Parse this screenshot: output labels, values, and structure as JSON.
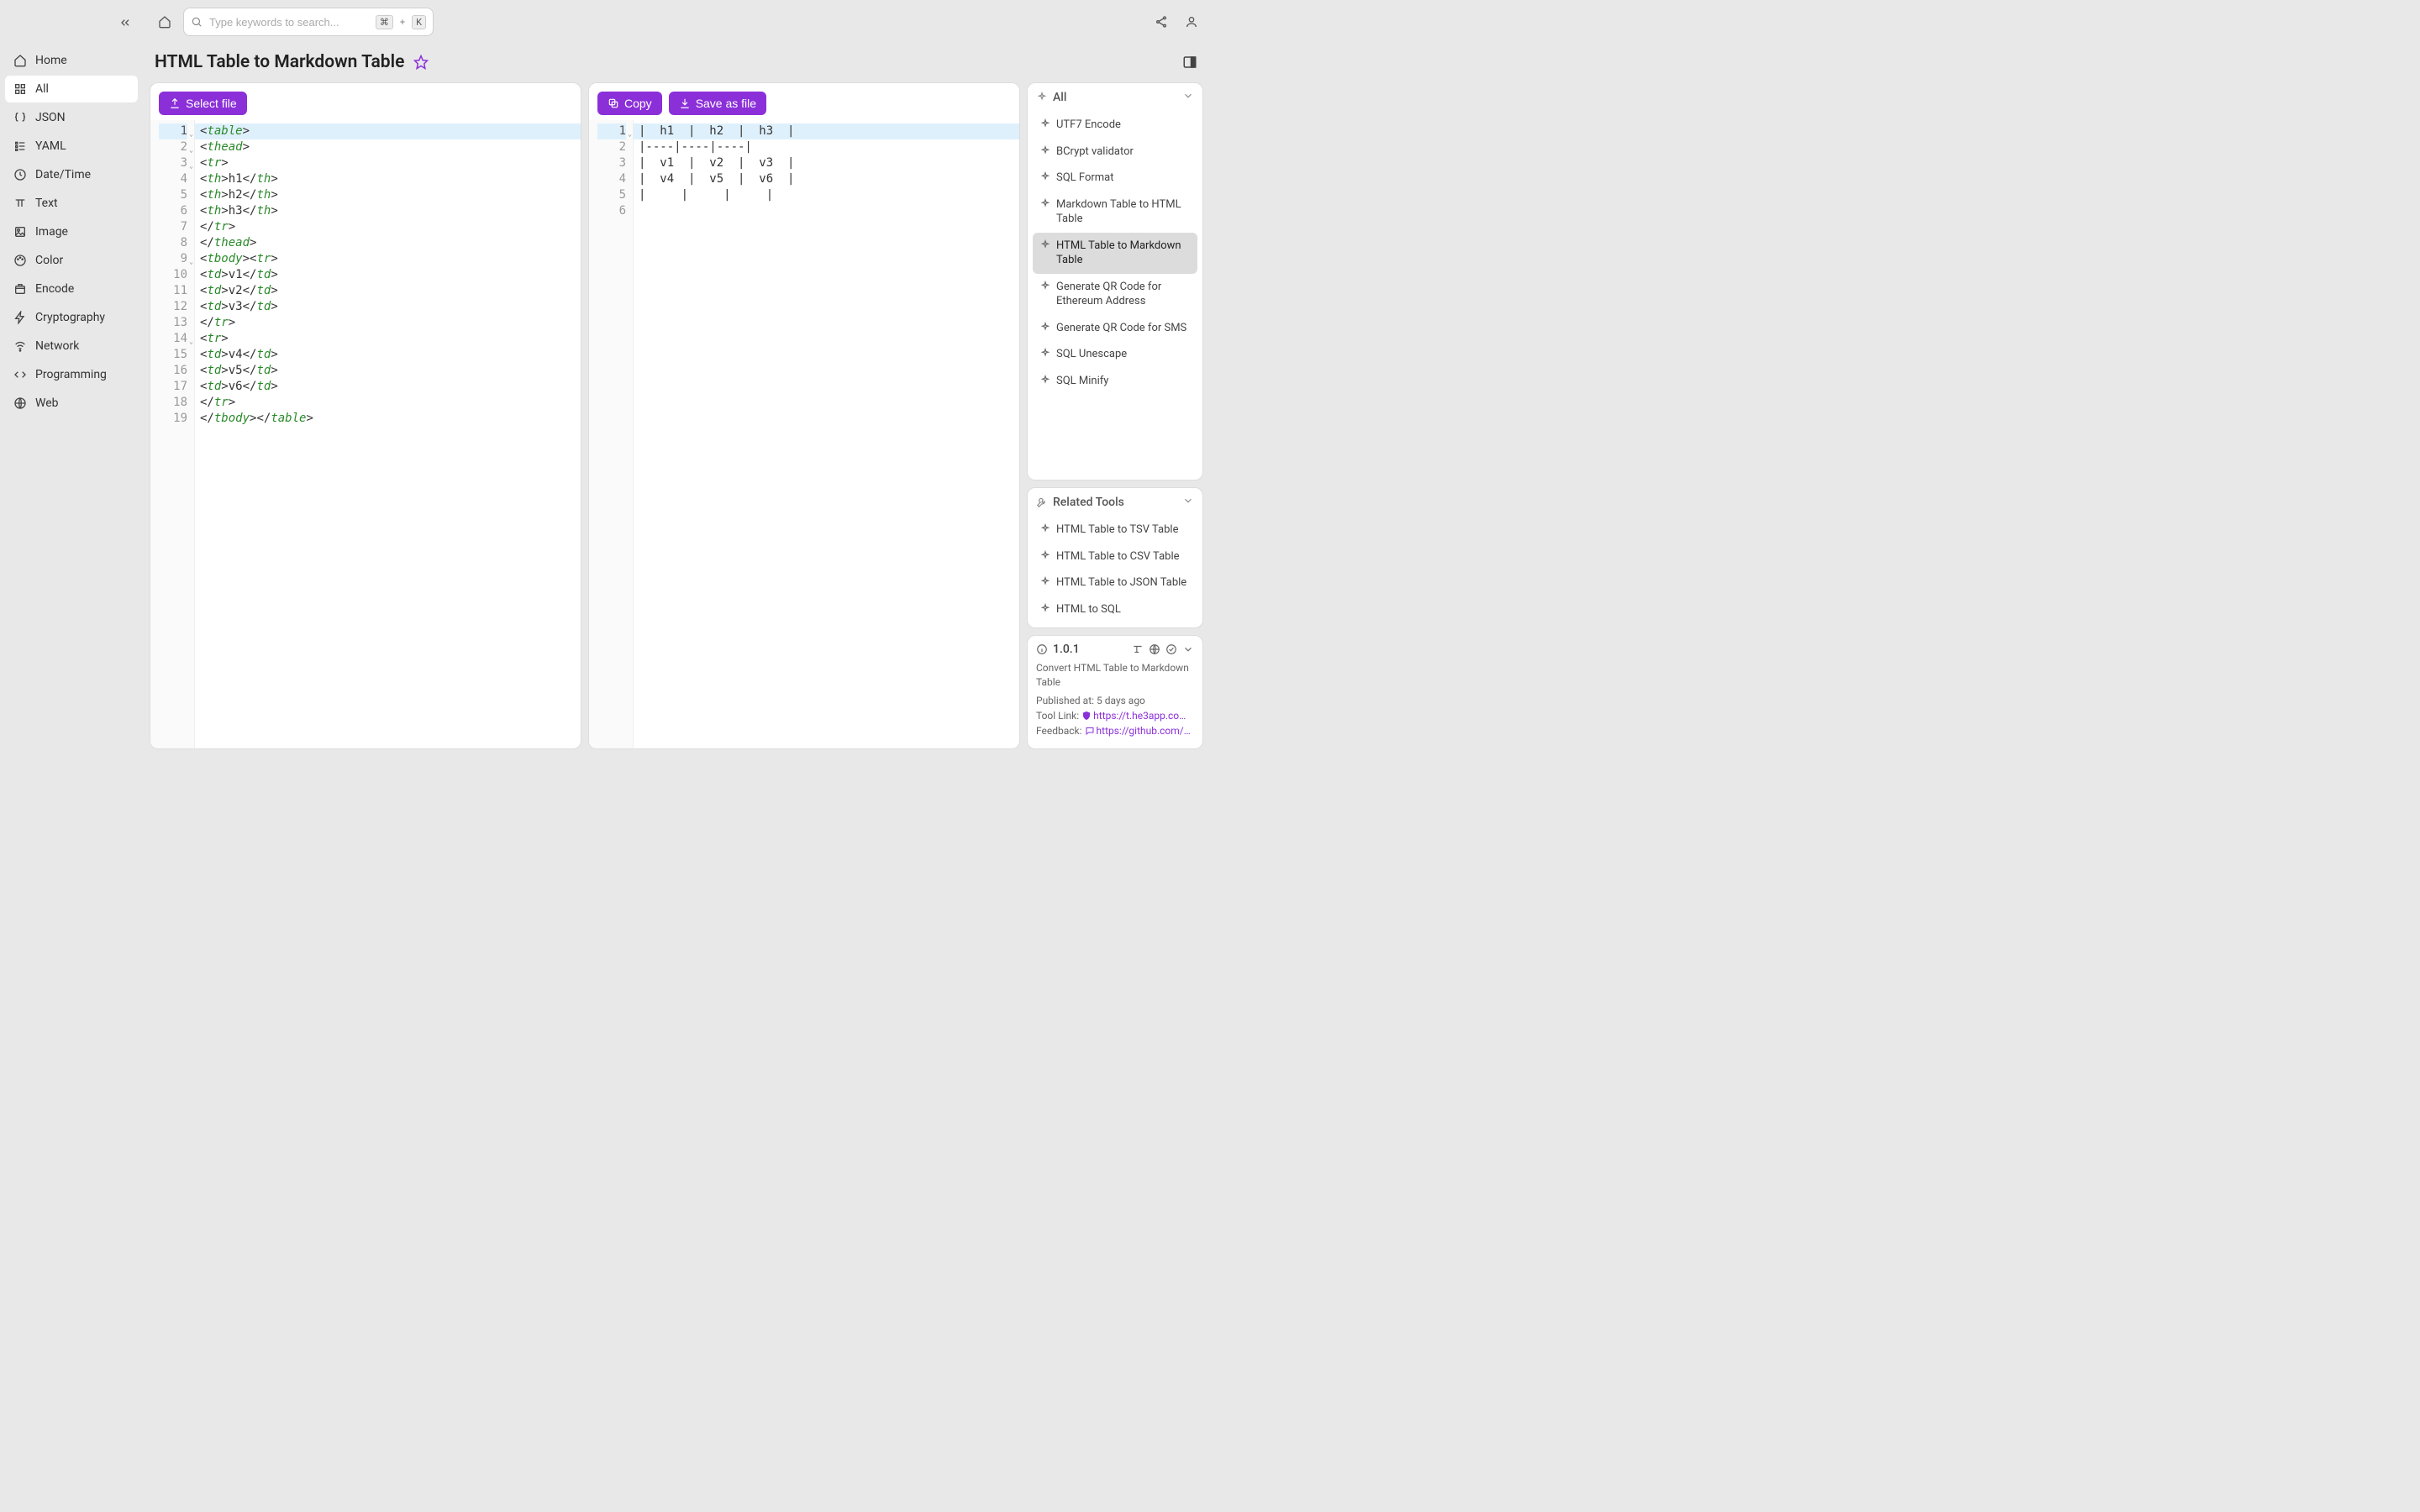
{
  "sidebar": {
    "items": [
      {
        "label": "Home",
        "icon": "home"
      },
      {
        "label": "All",
        "icon": "grid",
        "active": true
      },
      {
        "label": "JSON",
        "icon": "braces"
      },
      {
        "label": "YAML",
        "icon": "list"
      },
      {
        "label": "Date/Time",
        "icon": "clock"
      },
      {
        "label": "Text",
        "icon": "type"
      },
      {
        "label": "Image",
        "icon": "image"
      },
      {
        "label": "Color",
        "icon": "palette"
      },
      {
        "label": "Encode",
        "icon": "box"
      },
      {
        "label": "Cryptography",
        "icon": "bolt"
      },
      {
        "label": "Network",
        "icon": "wifi"
      },
      {
        "label": "Programming",
        "icon": "code"
      },
      {
        "label": "Web",
        "icon": "globe"
      }
    ]
  },
  "search": {
    "placeholder": "Type keywords to search...",
    "shortcut_mod": "⌘",
    "shortcut_plus": "+",
    "shortcut_key": "K"
  },
  "page_title": "HTML Table to Markdown Table",
  "left_editor": {
    "select_file_label": "Select file",
    "lines": [
      {
        "n": 1,
        "fold": true,
        "hl": true,
        "tokens": [
          [
            "punc",
            "<"
          ],
          [
            "tag",
            "table"
          ],
          [
            "punc",
            ">"
          ]
        ]
      },
      {
        "n": 2,
        "fold": true,
        "tokens": [
          [
            "punc",
            "<"
          ],
          [
            "tag",
            "thead"
          ],
          [
            "punc",
            ">"
          ]
        ]
      },
      {
        "n": 3,
        "fold": true,
        "tokens": [
          [
            "punc",
            "<"
          ],
          [
            "tag",
            "tr"
          ],
          [
            "punc",
            ">"
          ]
        ]
      },
      {
        "n": 4,
        "tokens": [
          [
            "punc",
            "<"
          ],
          [
            "tag",
            "th"
          ],
          [
            "punc",
            ">"
          ],
          [
            "txt",
            "h1"
          ],
          [
            "punc",
            "</"
          ],
          [
            "tag",
            "th"
          ],
          [
            "punc",
            ">"
          ]
        ]
      },
      {
        "n": 5,
        "tokens": [
          [
            "punc",
            "<"
          ],
          [
            "tag",
            "th"
          ],
          [
            "punc",
            ">"
          ],
          [
            "txt",
            "h2"
          ],
          [
            "punc",
            "</"
          ],
          [
            "tag",
            "th"
          ],
          [
            "punc",
            ">"
          ]
        ]
      },
      {
        "n": 6,
        "tokens": [
          [
            "punc",
            "<"
          ],
          [
            "tag",
            "th"
          ],
          [
            "punc",
            ">"
          ],
          [
            "txt",
            "h3"
          ],
          [
            "punc",
            "</"
          ],
          [
            "tag",
            "th"
          ],
          [
            "punc",
            ">"
          ]
        ]
      },
      {
        "n": 7,
        "tokens": [
          [
            "punc",
            "</"
          ],
          [
            "tag",
            "tr"
          ],
          [
            "punc",
            ">"
          ]
        ]
      },
      {
        "n": 8,
        "tokens": [
          [
            "punc",
            "</"
          ],
          [
            "tag",
            "thead"
          ],
          [
            "punc",
            ">"
          ]
        ]
      },
      {
        "n": 9,
        "fold": true,
        "tokens": [
          [
            "punc",
            "<"
          ],
          [
            "tag",
            "tbody"
          ],
          [
            "punc",
            "><"
          ],
          [
            "tag",
            "tr"
          ],
          [
            "punc",
            ">"
          ]
        ]
      },
      {
        "n": 10,
        "tokens": [
          [
            "punc",
            "<"
          ],
          [
            "tag",
            "td"
          ],
          [
            "punc",
            ">"
          ],
          [
            "txt",
            "v1"
          ],
          [
            "punc",
            "</"
          ],
          [
            "tag",
            "td"
          ],
          [
            "punc",
            ">"
          ]
        ]
      },
      {
        "n": 11,
        "tokens": [
          [
            "punc",
            "<"
          ],
          [
            "tag",
            "td"
          ],
          [
            "punc",
            ">"
          ],
          [
            "txt",
            "v2"
          ],
          [
            "punc",
            "</"
          ],
          [
            "tag",
            "td"
          ],
          [
            "punc",
            ">"
          ]
        ]
      },
      {
        "n": 12,
        "tokens": [
          [
            "punc",
            "<"
          ],
          [
            "tag",
            "td"
          ],
          [
            "punc",
            ">"
          ],
          [
            "txt",
            "v3"
          ],
          [
            "punc",
            "</"
          ],
          [
            "tag",
            "td"
          ],
          [
            "punc",
            ">"
          ]
        ]
      },
      {
        "n": 13,
        "tokens": [
          [
            "punc",
            "</"
          ],
          [
            "tag",
            "tr"
          ],
          [
            "punc",
            ">"
          ]
        ]
      },
      {
        "n": 14,
        "fold": true,
        "tokens": [
          [
            "punc",
            "<"
          ],
          [
            "tag",
            "tr"
          ],
          [
            "punc",
            ">"
          ]
        ]
      },
      {
        "n": 15,
        "tokens": [
          [
            "punc",
            "<"
          ],
          [
            "tag",
            "td"
          ],
          [
            "punc",
            ">"
          ],
          [
            "txt",
            "v4"
          ],
          [
            "punc",
            "</"
          ],
          [
            "tag",
            "td"
          ],
          [
            "punc",
            ">"
          ]
        ]
      },
      {
        "n": 16,
        "tokens": [
          [
            "punc",
            "<"
          ],
          [
            "tag",
            "td"
          ],
          [
            "punc",
            ">"
          ],
          [
            "txt",
            "v5"
          ],
          [
            "punc",
            "</"
          ],
          [
            "tag",
            "td"
          ],
          [
            "punc",
            ">"
          ]
        ]
      },
      {
        "n": 17,
        "tokens": [
          [
            "punc",
            "<"
          ],
          [
            "tag",
            "td"
          ],
          [
            "punc",
            ">"
          ],
          [
            "txt",
            "v6"
          ],
          [
            "punc",
            "</"
          ],
          [
            "tag",
            "td"
          ],
          [
            "punc",
            ">"
          ]
        ]
      },
      {
        "n": 18,
        "tokens": [
          [
            "punc",
            "</"
          ],
          [
            "tag",
            "tr"
          ],
          [
            "punc",
            ">"
          ]
        ]
      },
      {
        "n": 19,
        "tokens": [
          [
            "punc",
            "</"
          ],
          [
            "tag",
            "tbody"
          ],
          [
            "punc",
            "></"
          ],
          [
            "tag",
            "table"
          ],
          [
            "punc",
            ">"
          ]
        ]
      }
    ]
  },
  "right_editor": {
    "copy_label": "Copy",
    "save_as_file_label": "Save as file",
    "lines": [
      {
        "n": 1,
        "fold": true,
        "hl": true,
        "text": "|  h1  |  h2  |  h3  |"
      },
      {
        "n": 2,
        "text": "|----|----|----|"
      },
      {
        "n": 3,
        "text": "|  v1  |  v2  |  v3  |"
      },
      {
        "n": 4,
        "text": "|  v4  |  v5  |  v6  |"
      },
      {
        "n": 5,
        "text": "|     |     |     |"
      },
      {
        "n": 6,
        "text": ""
      }
    ]
  },
  "all_panel": {
    "header": "All",
    "items": [
      {
        "label": "UTF7 Encode"
      },
      {
        "label": "BCrypt validator"
      },
      {
        "label": "SQL Format"
      },
      {
        "label": "Markdown Table to HTML Table"
      },
      {
        "label": "HTML Table to Markdown Table",
        "active": true
      },
      {
        "label": "Generate QR Code for Ethereum Address"
      },
      {
        "label": "Generate QR Code for SMS"
      },
      {
        "label": "SQL Unescape"
      },
      {
        "label": "SQL Minify"
      }
    ]
  },
  "related_panel": {
    "header": "Related Tools",
    "items": [
      {
        "label": "HTML Table to TSV Table"
      },
      {
        "label": "HTML Table to CSV Table"
      },
      {
        "label": "HTML Table to JSON Table"
      },
      {
        "label": "HTML to SQL"
      }
    ]
  },
  "info": {
    "version": "1.0.1",
    "description": "Convert HTML Table to Markdown Table",
    "published_label": "Published at:",
    "published_value": "5 days ago",
    "tool_link_label": "Tool Link:",
    "tool_link_url": "https://t.he3app.co…",
    "feedback_label": "Feedback:",
    "feedback_url": "https://github.com/…"
  }
}
